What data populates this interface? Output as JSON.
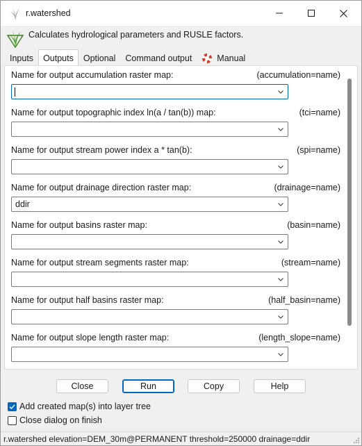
{
  "window": {
    "title": "r.watershed",
    "icon": "grass-icon"
  },
  "header": {
    "description": "Calculates hydrological parameters and RUSLE factors."
  },
  "tabs": [
    {
      "label": "Inputs"
    },
    {
      "label": "Outputs",
      "active": true
    },
    {
      "label": "Optional"
    },
    {
      "label": "Command output"
    },
    {
      "label": "Manual",
      "icon": "lifebuoy-icon"
    }
  ],
  "fields": [
    {
      "label": "Name for output accumulation raster map:",
      "param": "(accumulation=name)",
      "value": ""
    },
    {
      "label": "Name for output topographic index ln(a / tan(b)) map:",
      "param": "(tci=name)",
      "value": ""
    },
    {
      "label": "Name for output stream power index a * tan(b):",
      "param": "(spi=name)",
      "value": ""
    },
    {
      "label": "Name for output drainage direction raster map:",
      "param": "(drainage=name)",
      "value": "ddir"
    },
    {
      "label": "Name for output basins raster map:",
      "param": "(basin=name)",
      "value": ""
    },
    {
      "label": "Name for output stream segments raster map:",
      "param": "(stream=name)",
      "value": ""
    },
    {
      "label": "Name for output half basins raster map:",
      "param": "(half_basin=name)",
      "value": ""
    },
    {
      "label": "Name for output slope length raster map:",
      "param": "(length_slope=name)",
      "value": ""
    }
  ],
  "buttons": {
    "close": "Close",
    "run": "Run",
    "copy": "Copy",
    "help": "Help"
  },
  "options": {
    "add_to_tree": {
      "label": "Add created map(s) into layer tree",
      "checked": true
    },
    "close_on_finish": {
      "label": "Close dialog on finish",
      "checked": false
    }
  },
  "status": {
    "command": "r.watershed elevation=DEM_30m@PERMANENT threshold=250000 drainage=ddir"
  },
  "colors": {
    "accent": "#0067c0",
    "grass_green": "#4c9a2a",
    "lifebuoy_red": "#d33a2c"
  }
}
